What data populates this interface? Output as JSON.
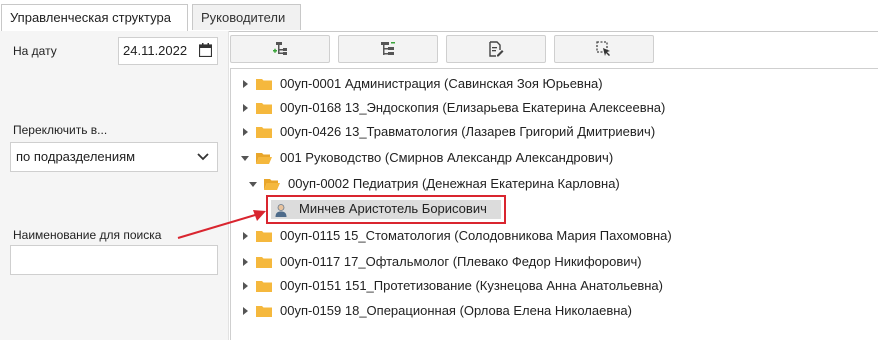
{
  "tabs": [
    {
      "label": "Управленческая структура",
      "active": true
    },
    {
      "label": "Руководители",
      "active": false
    }
  ],
  "filters": {
    "date_label": "На дату",
    "date_value": "24.11.2022",
    "switch_label": "Переключить в...",
    "switch_value": "по подразделениям",
    "search_label": "Наименование для поиска",
    "search_value": ""
  },
  "toolbar": {
    "buttons": [
      {
        "icon": "add-node-icon"
      },
      {
        "icon": "tree-structure-icon"
      },
      {
        "icon": "edit-document-icon"
      },
      {
        "icon": "select-cursor-icon"
      }
    ]
  },
  "tree": {
    "rows": [
      {
        "label": "00уп-0001 Администрация (Савинская Зоя Юрьевна)",
        "expanded": false,
        "level": 0
      },
      {
        "label": "00уп-0168 13_Эндоскопия (Елизарьева Екатерина Алексеевна)",
        "expanded": false,
        "level": 0
      },
      {
        "label": "00уп-0426 13_Травматология (Лазарев Григорий Дмитриевич)",
        "expanded": false,
        "level": 0
      },
      {
        "label": "001 Руководство (Смирнов Александр Александрович)",
        "expanded": true,
        "level": 0
      },
      {
        "label": "00уп-0002 Педиатрия (Денежная Екатерина Карловна)",
        "expanded": true,
        "level": 1
      },
      {
        "label": "Минчев Аристотель Борисович",
        "type": "person",
        "level": 2,
        "highlighted": true
      },
      {
        "label": "00уп-0115 15_Стоматология (Солодовникова Мария Пахомовна)",
        "expanded": false,
        "level": 0
      },
      {
        "label": "00уп-0117 17_Офтальмолог (Плевако Федор Никифорович)",
        "expanded": false,
        "level": 0
      },
      {
        "label": "00уп-0151 151_Протетизование (Кузнецова Анна Анатольевна)",
        "expanded": false,
        "level": 0
      },
      {
        "label": "00уп-0159 18_Операционная (Орлова Елена Николаевна)",
        "expanded": false,
        "level": 0
      }
    ]
  },
  "colors": {
    "folder": "#f5b83d",
    "highlight_border": "#d9252f",
    "annotation_arrow": "#d9252f"
  }
}
